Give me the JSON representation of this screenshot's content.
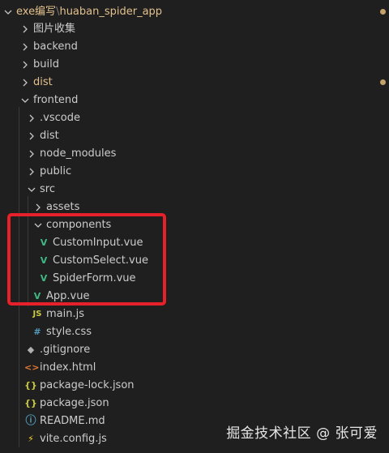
{
  "header": {
    "workspace": "exe编写",
    "separator": "\\",
    "project": "huaban_spider_app"
  },
  "tree": {
    "folder_tupian": "图片收集",
    "folder_backend": "backend",
    "folder_build": "build",
    "folder_dist": "dist",
    "folder_frontend": "frontend",
    "folder_vscode": ".vscode",
    "folder_fe_dist": "dist",
    "folder_node_modules": "node_modules",
    "folder_public": "public",
    "folder_src": "src",
    "folder_assets": "assets",
    "folder_components": "components",
    "file_custom_input": "CustomInput.vue",
    "file_custom_select": "CustomSelect.vue",
    "file_spider_form": "SpiderForm.vue",
    "file_app_vue": "App.vue",
    "file_main_js": "main.js",
    "file_style_css": "style.css",
    "file_gitignore": ".gitignore",
    "file_index_html": "index.html",
    "file_package_lock": "package-lock.json",
    "file_package_json": "package.json",
    "file_readme": "README.md",
    "file_vite_config": "vite.config.js"
  },
  "icons": {
    "vue": "V",
    "js": "JS",
    "css": "#",
    "html": "<>",
    "json": "{}",
    "info": "ⓘ",
    "git": "◆",
    "bolt": "⚡"
  },
  "watermark": "掘金技术社区 @ 张可爱",
  "colors": {
    "background": "#1f1f1f",
    "modified": "#e2c08d",
    "highlight": "#e8202a",
    "vue": "#41b883"
  }
}
